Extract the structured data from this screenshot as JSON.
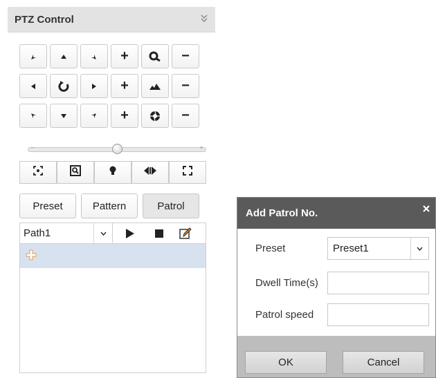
{
  "ptz": {
    "title": "PTZ Control",
    "collapse_icon": "double-chevron-down-icon",
    "direction_buttons": [
      "arrow-up-left-icon",
      "arrow-up-icon",
      "arrow-up-right-icon",
      "arrow-left-icon",
      "auto-pan-icon",
      "arrow-right-icon",
      "arrow-down-left-icon",
      "arrow-down-icon",
      "arrow-down-right-icon"
    ],
    "lens_rows": [
      {
        "plus": "+",
        "icon": "zoom-icon",
        "minus": "−"
      },
      {
        "plus": "+",
        "icon": "focus-icon",
        "minus": "−"
      },
      {
        "plus": "+",
        "icon": "iris-icon",
        "minus": "−"
      }
    ],
    "speed_slider": {
      "minus": "−",
      "plus": "+",
      "level": 0.5
    },
    "function_buttons": [
      "center-icon",
      "zoom-region-icon",
      "light-icon",
      "wiper-icon",
      "fullscreen-icon"
    ],
    "tabs": [
      "Preset",
      "Pattern",
      "Patrol"
    ],
    "active_tab": "Patrol",
    "path_select": {
      "value": "Path1"
    },
    "list_tools": [
      "play-icon",
      "stop-icon",
      "edit-icon"
    ],
    "add_icon": "plus-icon"
  },
  "dialog": {
    "title": "Add Patrol No.",
    "close_icon": "close-icon",
    "fields": {
      "preset_label": "Preset",
      "preset_value": "Preset1",
      "dwell_label": "Dwell Time(s)",
      "dwell_value": "",
      "speed_label": "Patrol speed",
      "speed_value": ""
    },
    "ok_label": "OK",
    "cancel_label": "Cancel"
  },
  "colors": {
    "header_bg": "#e3e3e3",
    "dialog_header": "#5a5a5a",
    "dialog_footer": "#bdbdbd",
    "list_highlight": "#d8e1ef",
    "icon_dark": "#222222",
    "edit_icon_accent": "#e27a1a"
  }
}
